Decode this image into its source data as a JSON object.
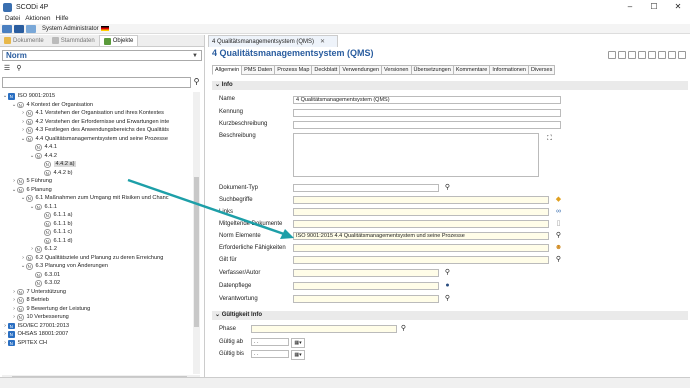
{
  "window": {
    "title": "SCODi 4P",
    "minimize": "–",
    "maximize": "☐",
    "close": "✕"
  },
  "menu": [
    "Datei",
    "Aktionen",
    "Hilfe"
  ],
  "userbar": {
    "user": "System Administrator"
  },
  "left": {
    "tabs": [
      "Dokumente",
      "Stammdaten",
      "Objekte"
    ],
    "selector": "Norm",
    "tree": [
      {
        "indent": 0,
        "exp": "⌄",
        "badge": "N",
        "badge_style": "blue",
        "label": "ISO 9001:2015"
      },
      {
        "indent": 1,
        "exp": "⌄",
        "badge": "N",
        "label": "4 Kontext der Organisation"
      },
      {
        "indent": 2,
        "exp": "›",
        "badge": "N",
        "label": "4.1 Verstehen der Organisation und ihres Kontextes"
      },
      {
        "indent": 2,
        "exp": "›",
        "badge": "N",
        "label": "4.2 Verstehen der Erfordernisse und Erwartungen inte"
      },
      {
        "indent": 2,
        "exp": "›",
        "badge": "N",
        "label": "4.3 Festlegen des Anwendungsbereichs des Qualitäts"
      },
      {
        "indent": 2,
        "exp": "⌄",
        "badge": "N",
        "label": "4.4 Qualitätsmanagementsystem und seine Prozesse"
      },
      {
        "indent": 3,
        "exp": "",
        "badge": "N",
        "label": "4.4.1"
      },
      {
        "indent": 3,
        "exp": "⌄",
        "badge": "N",
        "label": "4.4.2"
      },
      {
        "indent": 4,
        "exp": "",
        "badge": "N",
        "label": "4.4.2 a)",
        "selected": true
      },
      {
        "indent": 4,
        "exp": "",
        "badge": "N",
        "label": "4.4.2 b)"
      },
      {
        "indent": 1,
        "exp": "›",
        "badge": "N",
        "label": "5 Führung"
      },
      {
        "indent": 1,
        "exp": "⌄",
        "badge": "N",
        "label": "6 Planung"
      },
      {
        "indent": 2,
        "exp": "⌄",
        "badge": "N",
        "label": "6.1 Maßnahmen zum Umgang mit Risiken und Chanc"
      },
      {
        "indent": 3,
        "exp": "⌄",
        "badge": "N",
        "label": "6.1.1"
      },
      {
        "indent": 4,
        "exp": "",
        "badge": "N",
        "label": "6.1.1 a)"
      },
      {
        "indent": 4,
        "exp": "",
        "badge": "N",
        "label": "6.1.1 b)"
      },
      {
        "indent": 4,
        "exp": "",
        "badge": "N",
        "label": "6.1.1 c)"
      },
      {
        "indent": 4,
        "exp": "",
        "badge": "N",
        "label": "6.1.1 d)"
      },
      {
        "indent": 3,
        "exp": "›",
        "badge": "N",
        "label": "6.1.2"
      },
      {
        "indent": 2,
        "exp": "›",
        "badge": "N",
        "label": "6.2 Qualitätsziele und Planung zu deren Erreichung"
      },
      {
        "indent": 2,
        "exp": "⌄",
        "badge": "N",
        "label": "6.3 Planung von Änderungen"
      },
      {
        "indent": 3,
        "exp": "",
        "badge": "N",
        "label": "6.3.01"
      },
      {
        "indent": 3,
        "exp": "",
        "badge": "N",
        "label": "6.3.02"
      },
      {
        "indent": 1,
        "exp": "›",
        "badge": "N",
        "label": "7 Unterstützung"
      },
      {
        "indent": 1,
        "exp": "›",
        "badge": "N",
        "label": "8 Betrieb"
      },
      {
        "indent": 1,
        "exp": "›",
        "badge": "N",
        "label": "9 Bewertung der Leistung"
      },
      {
        "indent": 1,
        "exp": "›",
        "badge": "N",
        "label": "10 Verbesserung"
      },
      {
        "indent": 0,
        "exp": "›",
        "badge": "N",
        "badge_style": "blue",
        "label": "ISO/IEC 27001:2013"
      },
      {
        "indent": 0,
        "exp": "›",
        "badge": "N",
        "badge_style": "blue",
        "label": "OHSAS 18001:2007"
      },
      {
        "indent": 0,
        "exp": "›",
        "badge": "N",
        "badge_style": "blue",
        "label": "SPITEX CH"
      }
    ]
  },
  "right": {
    "tab_label": "4 Qualitätsmanagementsystem (QMS)",
    "tab_close": "✕",
    "title": "4 Qualitätsmanagementsystem (QMS)",
    "form_tabs": [
      "Allgemein",
      "PMS Daten",
      "Prozess Map",
      "Deckblatt",
      "Verwendungen",
      "Versionen",
      "Übersetzungen",
      "Kommentare",
      "Informationen",
      "Diverses"
    ],
    "section_info": "Info",
    "section_validity": "Gültigkeit Info",
    "fields": {
      "name_label": "Name",
      "name_value": "4 Qualitätsmanagementsystem (QMS)",
      "kennung_label": "Kennung",
      "kurz_label": "Kurzbeschreibung",
      "beschreibung_label": "Beschreibung",
      "doktyp_label": "Dokument-Typ",
      "such_label": "Suchbegriffe",
      "links_label": "Links",
      "mitgel_label": "Mitgeltende Dokumente",
      "normel_label": "Norm Elemente",
      "normel_value": "ISO 9001:2015 4.4 Qualitätsmanagementsystem und seine Prozesse",
      "faehig_label": "Erforderliche Fähigkeiten",
      "gilt_label": "Gilt für",
      "verf_label": "Verfasser/Autor",
      "pflege_label": "Datenpflege",
      "verant_label": "Verantwortung",
      "phase_label": "Phase",
      "gab_label": "Gültig ab",
      "gab_value": ". .",
      "gbis_label": "Gültig bis",
      "gbis_value": ". ."
    }
  }
}
